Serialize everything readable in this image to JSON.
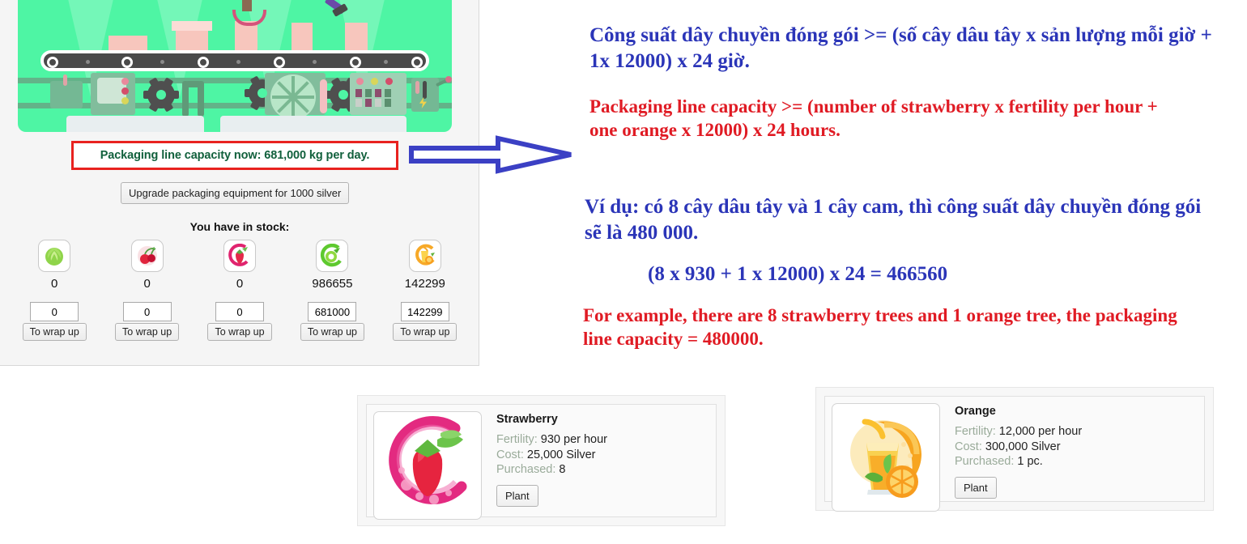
{
  "game_panel": {
    "factory_illustration_alt": "packaging-conveyor-line-illustration",
    "capacity_banner": "Packaging line capacity now: 681,000 kg per day.",
    "upgrade_button": "Upgrade packaging equipment for 1000 silver",
    "stock_title": "You have in stock:",
    "stock": [
      {
        "icon": "cabbage-icon",
        "count": "0",
        "input_value": "0",
        "wrap_button": "To wrap up"
      },
      {
        "icon": "cherry-icon",
        "count": "0",
        "input_value": "0",
        "wrap_button": "To wrap up"
      },
      {
        "icon": "strawberry-icon",
        "count": "0",
        "input_value": "0",
        "wrap_button": "To wrap up"
      },
      {
        "icon": "green-apple-icon",
        "count": "986655",
        "input_value": "681000",
        "wrap_button": "To wrap up"
      },
      {
        "icon": "orange-juice-icon",
        "count": "142299",
        "input_value": "142299",
        "wrap_button": "To wrap up"
      }
    ]
  },
  "annotations": {
    "arrow": "right-block-arrow",
    "vi_rule": "Công suất dây chuyền đóng gói >= (số cây dâu tây x sản lượng mỗi giờ + 1x 12000) x 24 giờ.",
    "en_rule": "Packaging line capacity >= (number of strawberry x fertility per hour + one orange x 12000) x 24 hours.",
    "vi_example": "Ví dụ: có 8 cây dâu tây và 1 cây cam, thì công suất dây chuyền đóng gói sẽ là 480 000.",
    "vi_calc": "(8 x 930 + 1 x 12000) x 24 = 466560",
    "en_example": "For example, there are 8 strawberry trees and 1 orange tree, the packaging line capacity = 480000."
  },
  "plants": [
    {
      "id": "strawberry",
      "icon": "strawberry-splash-image",
      "name": "Strawberry",
      "fertility_label": "Fertility:",
      "fertility_value": "930 per hour",
      "cost_label": "Cost:",
      "cost_value": "25,000 Silver",
      "purchased_label": "Purchased:",
      "purchased_value": "8",
      "plant_button": "Plant"
    },
    {
      "id": "orange",
      "icon": "orange-juice-glass-image",
      "name": "Orange",
      "fertility_label": "Fertility:",
      "fertility_value": "12,000 per hour",
      "cost_label": "Cost:",
      "cost_value": "300,000 Silver",
      "purchased_label": "Purchased:",
      "purchased_value": "1 pc.",
      "plant_button": "Plant"
    }
  ],
  "colors": {
    "annotation_blue": "#2b35b8",
    "annotation_red": "#e01b24",
    "capacity_border_red": "#e8221f",
    "capacity_text_green": "#11603c",
    "factory_green": "#4ef5a4",
    "panel_bg": "#f5f5f5"
  }
}
